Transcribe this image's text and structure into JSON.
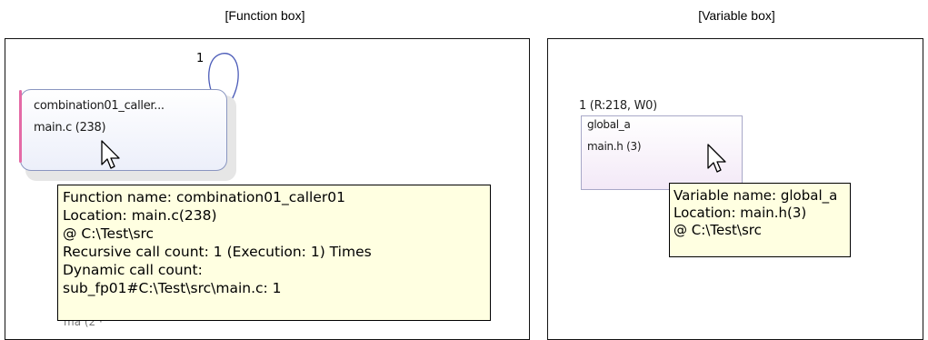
{
  "captions": {
    "function_box": "[Function box]",
    "variable_box": "[Variable box]"
  },
  "function_panel": {
    "loop_count": "1",
    "node": {
      "name": "combination01_caller...",
      "location": "main.c (238)"
    },
    "tooltip": {
      "lines": [
        "Function name: combination01_caller01",
        "Location: main.c(238)",
        " @ C:\\Test\\src",
        "Recursive call count: 1 (Execution: 1) Times",
        "Dynamic call count:",
        " sub_fp01#C:\\Test\\src\\main.c: 1"
      ]
    },
    "overlap_fragment": "ma    (2 ·"
  },
  "variable_panel": {
    "header": "1 (R:218, W0)",
    "node": {
      "name": "global_a",
      "location": "main.h (3)"
    },
    "tooltip": {
      "lines": [
        "Variable name: global_a",
        "Location: main.h(3)",
        " @ C:\\Test\\src"
      ]
    }
  },
  "colors": {
    "tooltip_bg": "#ffffe1",
    "node_border": "#8a96c0",
    "accent": "#e46aa6"
  }
}
